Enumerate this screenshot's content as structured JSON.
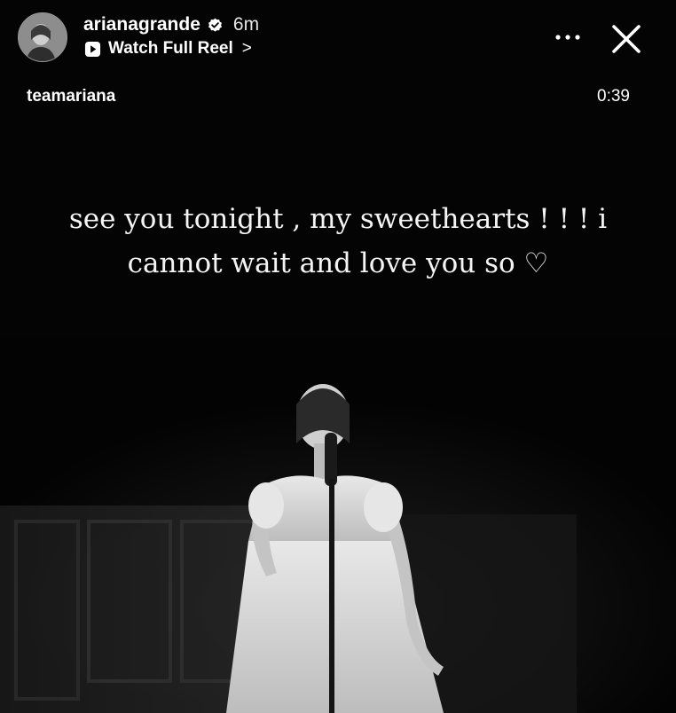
{
  "header": {
    "username": "arianagrande",
    "time_ago": "6m",
    "reel_link": "Watch Full Reel",
    "reel_chevron": ">",
    "more_icon": "more-horizontal-icon",
    "close_icon": "close-icon",
    "verified_icon": "verified-badge-icon"
  },
  "audio": {
    "label": "teamariana",
    "duration": "0:39"
  },
  "caption": {
    "line1": "see you tonight , my sweethearts ! ! ! i",
    "line2": "cannot wait and love you so ♡"
  },
  "colors": {
    "background": "#040404",
    "text": "#ffffff"
  }
}
